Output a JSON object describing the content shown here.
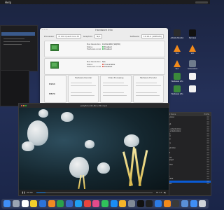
{
  "menubar": {
    "app_name": "Help"
  },
  "hardware_window": {
    "title": "Hardware Info",
    "toolbar": {
      "processor_label": "Processor",
      "processor_value": "I3 ID2 Quad Core M",
      "graphics_label": "Graphics",
      "graphics_value": "N/A",
      "software_label": "Software",
      "software_value": "10.14.4 (18E226)"
    },
    "cards": [
      {
        "rows": [
          {
            "k": "Max Resolution",
            "v": "1920x1080 (WQHD)"
          },
          {
            "k": "Status",
            "v": "Enabled"
          },
          {
            "k": "Hardware Accel",
            "v": "Enabled"
          }
        ]
      },
      {
        "rows": [
          {
            "k": "Max Resolution",
            "v": "N/A"
          },
          {
            "k": "Status",
            "v": "Unavailable"
          },
          {
            "k": "Hardware Accel",
            "v": "Disabled"
          }
        ]
      }
    ],
    "sections": [
      {
        "title": "Hardware Decoder"
      },
      {
        "title": "Video Processing"
      },
      {
        "title": "Hardware Encoder"
      }
    ],
    "codecs": [
      "H264",
      "HEVC"
    ]
  },
  "player": {
    "title": "Jellyfish-4K-Ultra-HD.mp4",
    "time_left": "00:04",
    "time_right": "01:13",
    "progress": 0.08
  },
  "panel": {
    "header": [
      "Format Name",
      "Profile"
    ],
    "rows": [
      {
        "name": "apple-hevc",
        "val": "4.0"
      },
      {
        "name": "h264",
        "val": "4.0"
      },
      {
        "name": "hevc",
        "val": "4.0"
      },
      {
        "name": "mpeg4",
        "val": "4.0"
      },
      {
        "name": "vp9",
        "val": "4.0"
      },
      {
        "name": "h264_videotoolbox",
        "val": "4.0"
      },
      {
        "name": "hevc_videotoolbox",
        "val": "4.0"
      },
      {
        "name": "prores",
        "val": "4.0"
      },
      {
        "name": "dnxhd",
        "val": "4.0"
      },
      {
        "name": "mjpeg",
        "val": "4.0"
      },
      {
        "name": "av1",
        "val": "4.0"
      },
      {
        "name": "theora",
        "val": "4.0"
      },
      {
        "name": "vp8",
        "val": "4.0"
      },
      {
        "name": "mpeg2video",
        "val": "4.0"
      },
      {
        "name": "h263",
        "val": "4.0"
      },
      {
        "name": "wmv3",
        "val": "4.0"
      },
      {
        "name": "vc1",
        "val": "4.0"
      },
      {
        "name": "cinepak",
        "val": "4.0"
      },
      {
        "name": "msmpeg4",
        "val": "4.0"
      },
      {
        "name": "flv1",
        "val": "4.0"
      },
      {
        "name": "rawvideo",
        "val": "4.0"
      },
      {
        "name": "ffv1",
        "val": "4.0"
      },
      {
        "name": "png",
        "val": "4.0"
      },
      {
        "name": "gif",
        "val": "4.0"
      },
      {
        "name": "tiff",
        "val": "4.0"
      },
      {
        "name": "webp",
        "val": "4.0"
      },
      {
        "name": "jpeg2000",
        "val": "4.0"
      },
      {
        "name": "bmp",
        "val": "4.0"
      },
      {
        "name": "dvvideo",
        "val": "4.0"
      }
    ],
    "selected_index": 27
  },
  "desktop_icons": [
    {
      "label": "Activity Monitor",
      "icon": "activity-icon",
      "color": "#2b2b2b"
    },
    {
      "label": "Terminal",
      "icon": "terminal-icon",
      "color": "#111111"
    },
    {
      "label": "VLC",
      "icon": "vlc-icon",
      "color": "#f28a1b"
    },
    {
      "label": "VLC",
      "icon": "vlc-icon",
      "color": "#f28a1b"
    },
    {
      "label": "VLC",
      "icon": "vlc-icon",
      "color": "#f28a1b"
    },
    {
      "label": "Screenshot",
      "icon": "screenshot-icon",
      "color": "#6f7c8c"
    },
    {
      "label": "Hardware Info",
      "icon": "chip-icon",
      "color": "#3b8a3b"
    },
    {
      "label": "",
      "icon": "document-icon",
      "color": "#f2f2f2"
    },
    {
      "label": "Hardware Info",
      "icon": "chip-icon",
      "color": "#3b8a3b"
    },
    {
      "label": "",
      "icon": "document-icon",
      "color": "#f2f2f2"
    }
  ],
  "dock_apps": [
    {
      "icon": "finder-icon",
      "color": "#3f8ef5"
    },
    {
      "icon": "launchpad-icon",
      "color": "#9aa4b3"
    },
    {
      "icon": "calendar-icon",
      "color": "#ffffff"
    },
    {
      "icon": "notes-icon",
      "color": "#f2d02b"
    },
    {
      "icon": "app-icon",
      "color": "#2b73d9"
    },
    {
      "icon": "pages-icon",
      "color": "#f08a23"
    },
    {
      "icon": "numbers-icon",
      "color": "#2aa14b"
    },
    {
      "icon": "keynote-icon",
      "color": "#3568c6"
    },
    {
      "icon": "safari-icon",
      "color": "#1f9ff0"
    },
    {
      "icon": "chrome-icon",
      "color": "#e8453c"
    },
    {
      "icon": "itunes-icon",
      "color": "#e14b8b"
    },
    {
      "icon": "messages-icon",
      "color": "#30c15b"
    },
    {
      "icon": "appstore-icon",
      "color": "#1a8cf4"
    },
    {
      "icon": "photos-icon",
      "color": "#f5b529"
    },
    {
      "icon": "settings-icon",
      "color": "#808a96"
    },
    {
      "icon": "terminal-icon",
      "color": "#111111"
    },
    {
      "icon": "activity-icon",
      "color": "#202020"
    },
    {
      "icon": "xcode-icon",
      "color": "#2c7be5"
    },
    {
      "icon": "vlc-icon",
      "color": "#f28a1b"
    },
    {
      "icon": "quicktime-icon",
      "color": "#3a3a3a"
    },
    {
      "icon": "preview-icon",
      "color": "#5a8fd6"
    },
    {
      "icon": "downloads-icon",
      "color": "#3f8ef5"
    },
    {
      "icon": "trash-icon",
      "color": "#cfd4da"
    }
  ]
}
